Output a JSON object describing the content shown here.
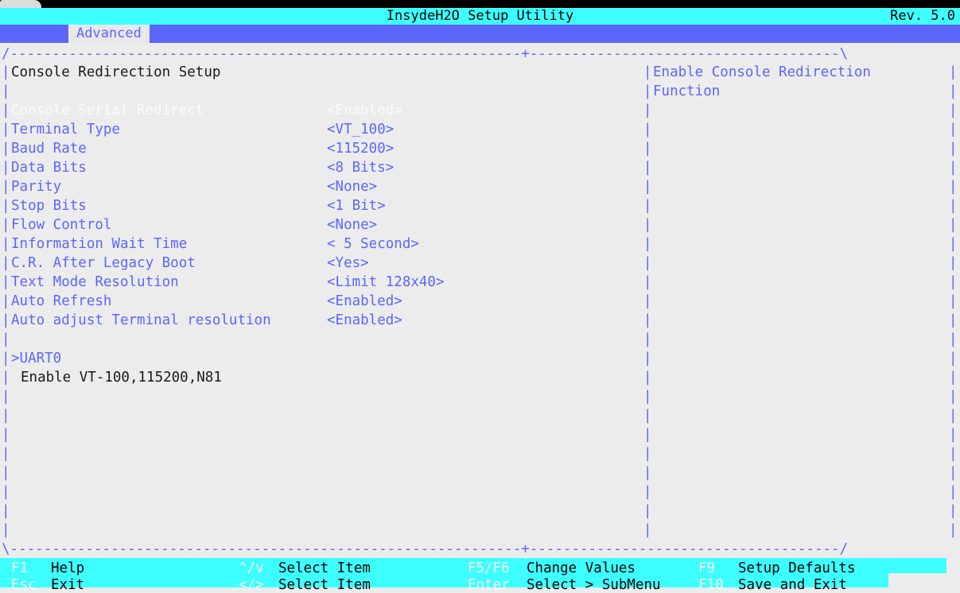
{
  "window": {
    "title": "InsydeH2O Setup Utility",
    "revision": "Rev. 5.0"
  },
  "colors": {
    "title_bar": "#3dffff",
    "menu_bar": "#5c66fb",
    "accent_blue": "#5c66fb",
    "background": "#ececec",
    "selected_text": "#fbfbfb",
    "body_text": "#1a1a1a"
  },
  "menu": {
    "tabs": [
      {
        "label": "Advanced",
        "active": true
      }
    ]
  },
  "panel": {
    "heading": "Console Redirection Setup",
    "frame": {
      "top": "/-------------------------------------------------------------+-------------------------------------\\",
      "bottom": "\\-------------------------------------------------------------+-------------------------------------/",
      "vbar": "|"
    },
    "settings": [
      {
        "label": "Console Serial Redirect",
        "value": "<Enabled>",
        "selected": true
      },
      {
        "label": "Terminal Type",
        "value": "<VT_100>",
        "selected": false
      },
      {
        "label": "Baud Rate",
        "value": "<115200>",
        "selected": false
      },
      {
        "label": "Data Bits",
        "value": "<8 Bits>",
        "selected": false
      },
      {
        "label": "Parity",
        "value": "<None>",
        "selected": false
      },
      {
        "label": "Stop Bits",
        "value": "<1 Bit>",
        "selected": false
      },
      {
        "label": "Flow Control",
        "value": "<None>",
        "selected": false
      },
      {
        "label": "Information Wait Time",
        "value": "< 5 Second>",
        "selected": false
      },
      {
        "label": "C.R. After Legacy Boot",
        "value": "<Yes>",
        "selected": false
      },
      {
        "label": "Text Mode Resolution",
        "value": "<Limit 128x40>",
        "selected": false
      },
      {
        "label": "Auto Refresh",
        "value": "<Enabled>",
        "selected": false
      },
      {
        "label": "Auto adjust Terminal resolution",
        "value": "<Enabled>",
        "selected": false
      }
    ],
    "submenu": {
      "label": ">UART0",
      "description": "Enable VT-100,115200,N81"
    }
  },
  "help": {
    "lines": [
      "Enable Console Redirection",
      "Function"
    ]
  },
  "footer": {
    "row1": [
      {
        "key": "F1",
        "text": "Help"
      },
      {
        "key": "^/v",
        "text": "Select Item"
      },
      {
        "key": "F5/F6",
        "text": "Change Values"
      },
      {
        "key": "F9",
        "text": "Setup Defaults"
      }
    ],
    "row2": [
      {
        "key": "Esc",
        "text": "Exit"
      },
      {
        "key": "</>",
        "text": "Select Item"
      },
      {
        "key": "Enter",
        "text": "Select > SubMenu"
      },
      {
        "key": "F10",
        "text": "Save and Exit"
      }
    ]
  }
}
